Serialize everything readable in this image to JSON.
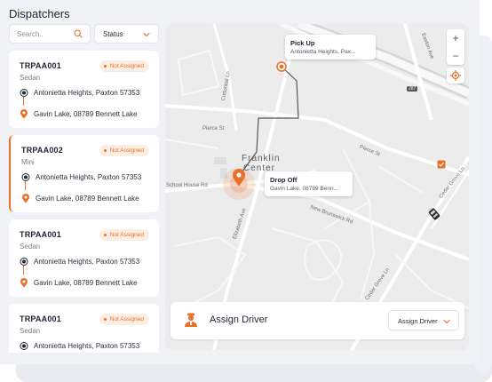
{
  "header": {
    "title": "Dispatchers"
  },
  "search": {
    "placeholder": "Search..",
    "value": "",
    "icon": "search-icon"
  },
  "status_filter": {
    "label": "Status",
    "icon": "chevron-down-icon"
  },
  "trips": [
    {
      "id": "TRPAA001",
      "vehicle": "Sedan",
      "status": "Not Assigned",
      "pickup": "Antonietta Heights, Paxton 57353",
      "dropoff": "Gavin Lake, 08789 Bennett Lake"
    },
    {
      "id": "TRPAA002",
      "vehicle": "Mini",
      "status": "Not Assigned",
      "pickup": "Antonietta Heights, Paxton 57353",
      "dropoff": "Gavin Lake, 08789 Bennett Lake",
      "selected": true
    },
    {
      "id": "TRPAA001",
      "vehicle": "Sedan",
      "status": "Not Assigned",
      "pickup": "Antonietta Heights, Paxton 57353",
      "dropoff": "Gavin Lake, 08789 Bennett Lake"
    },
    {
      "id": "TRPAA001",
      "vehicle": "Sedan",
      "status": "Not Assigned",
      "pickup": "Antonietta Heights, Paxton 57353"
    }
  ],
  "map": {
    "pickup": {
      "title": "Pick Up",
      "address": "Antonietta Heights, Pax..."
    },
    "dropoff": {
      "title": "Drop Off",
      "address": "Gavin Lake, 08789 Benn..."
    },
    "town_line1": "Franklin",
    "town_line2": "Center",
    "streets": {
      "pierce_st_west": "Pierce St",
      "pierce_st_east": "Pierce St",
      "school_house": "School House Rd",
      "elizabeth": "Elizabeth Ave",
      "new_brunswick": "New Brunswick Rd",
      "cottontail": "Cottontail Ln",
      "easton": "Easton Ave",
      "cedar_grove_east": "Cedar Grove Ln",
      "cedar_grove_south": "Cedar Grove Ln",
      "route_shield": "287"
    },
    "zoom_in": "+",
    "zoom_out": "−"
  },
  "assign_bar": {
    "label": "Assign Driver",
    "dropdown_label": "Assign Driver",
    "icon": "driver-avatar-icon"
  },
  "colors": {
    "accent": "#e8702a",
    "background": "#f1f2f6",
    "card": "#ffffff",
    "map": "#ececec"
  }
}
